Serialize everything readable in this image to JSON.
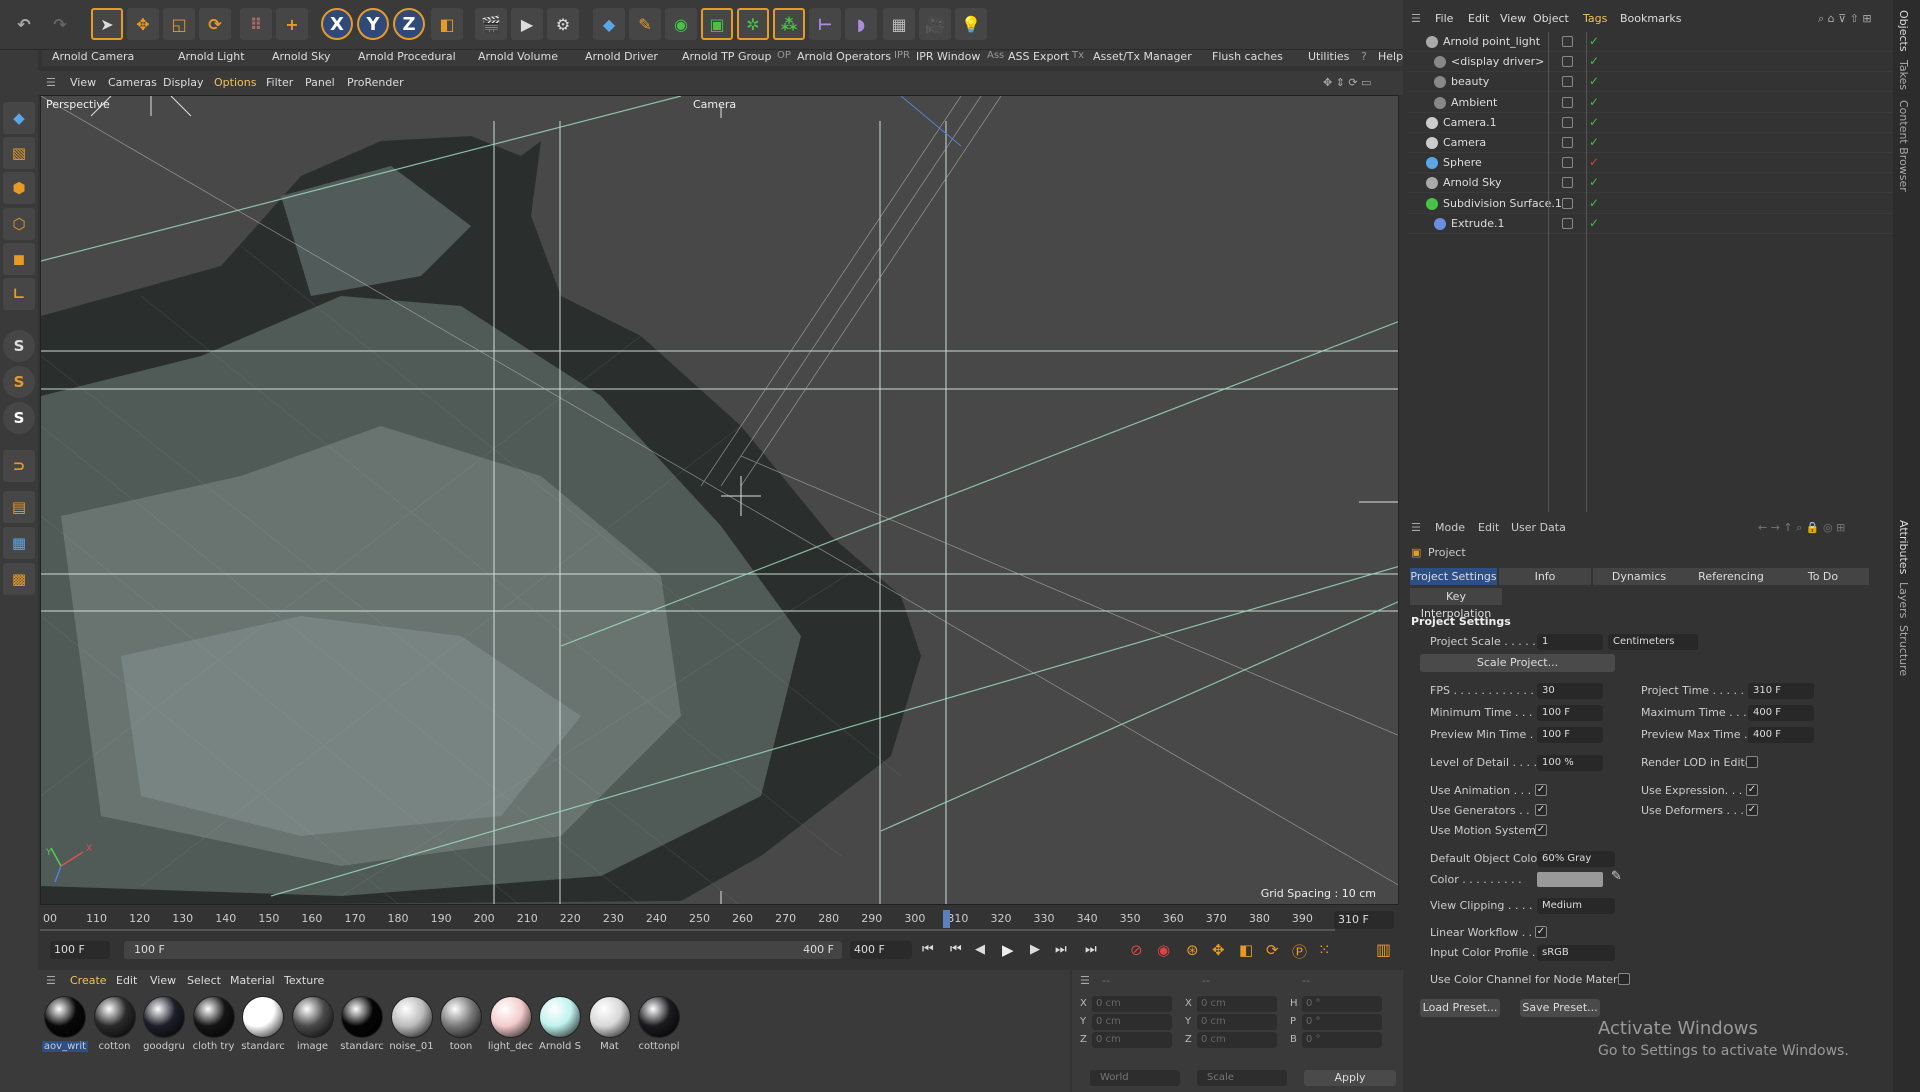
{
  "toolbar": {
    "icons": [
      "undo-icon",
      "redo-icon",
      "select-icon",
      "move-icon",
      "scale-icon",
      "rotate-icon",
      "model-icon",
      "add-icon",
      "x-axis-icon",
      "y-axis-icon",
      "z-axis-icon",
      "coord-system-icon",
      "render-region-icon",
      "render-view-icon",
      "render-settings-icon",
      "cube-icon",
      "pen-icon",
      "subdivision-icon",
      "extrude-icon",
      "mograph-icon",
      "array-icon",
      "symmetry-icon",
      "deformer-icon",
      "floor-icon",
      "camera-icon",
      "light-icon"
    ],
    "axis_x": "X",
    "axis_y": "Y",
    "axis_z": "Z"
  },
  "plugin_bar": [
    "Arnold Camera",
    "Arnold Light",
    "Arnold Sky",
    "Arnold Procedural",
    "Arnold Volume",
    "Arnold Driver",
    "Arnold TP Group",
    "Arnold Operators",
    "IPR Window",
    "ASS Export",
    "Asset/Tx Manager",
    "Flush caches",
    "Utilities",
    "Help"
  ],
  "plugin_bar_prefixes": [
    "IPR",
    "Ass",
    "Tx",
    "?"
  ],
  "viewport": {
    "menu": [
      "View",
      "Cameras",
      "Display",
      "Options",
      "Filter",
      "Panel",
      "ProRender"
    ],
    "active_menu": "Options",
    "view_name": "Perspective",
    "camera_label": "Camera",
    "grid_spacing": "Grid Spacing : 10 cm",
    "axis_labels": [
      "X",
      "Y"
    ]
  },
  "timeline": {
    "ticks": [
      "00",
      "110",
      "120",
      "130",
      "140",
      "150",
      "160",
      "170",
      "180",
      "190",
      "200",
      "210",
      "220",
      "230",
      "240",
      "250",
      "260",
      "270",
      "280",
      "290",
      "300",
      "310",
      "320",
      "330",
      "340",
      "350",
      "360",
      "370",
      "380",
      "390",
      "400"
    ],
    "current_frame": "310 F",
    "current_marker": "310"
  },
  "playback": {
    "start": "100 F",
    "range_start": "100 F",
    "range_end": "400 F",
    "end": "400 F"
  },
  "materials": {
    "menu": [
      "Create",
      "Edit",
      "View",
      "Select",
      "Material",
      "Texture"
    ],
    "items": [
      {
        "name": "aov_writ",
        "color": "#080808"
      },
      {
        "name": "cotton",
        "color": "#2a2a2a"
      },
      {
        "name": "goodgru",
        "color": "#1e1e2a"
      },
      {
        "name": "cloth try",
        "color": "#151515"
      },
      {
        "name": "standarc",
        "color": "#ffffff"
      },
      {
        "name": "image",
        "color": "#4a4a4a"
      },
      {
        "name": "standarc",
        "color": "#050505"
      },
      {
        "name": "noise_01",
        "color": "#bcbcbc"
      },
      {
        "name": "toon",
        "color": "#7a7a7a"
      },
      {
        "name": "light_dec",
        "color": "#f4cccc"
      },
      {
        "name": "Arnold S",
        "color": "#bff2ee"
      },
      {
        "name": "Mat",
        "color": "#d8d8d8"
      },
      {
        "name": "cottonpl",
        "color": "#1b1b1f"
      }
    ]
  },
  "coordinates": {
    "header": [
      "--",
      "--",
      "--"
    ],
    "rows": [
      {
        "a": "X",
        "av": "0 cm",
        "b": "X",
        "bv": "0 cm",
        "c": "H",
        "cv": "0 °"
      },
      {
        "a": "Y",
        "av": "0 cm",
        "b": "Y",
        "bv": "0 cm",
        "c": "P",
        "cv": "0 °"
      },
      {
        "a": "Z",
        "av": "0 cm",
        "b": "Z",
        "bv": "0 cm",
        "c": "B",
        "cv": "0 °"
      }
    ],
    "world": "World",
    "scale": "Scale",
    "apply": "Apply"
  },
  "object_manager": {
    "menu": [
      "File",
      "Edit",
      "View",
      "Object",
      "Tags",
      "Bookmarks"
    ],
    "objects": [
      {
        "name": "Arnold point_light",
        "color": "#aaaaaa"
      },
      {
        "name": "<display driver>",
        "color": "#888888"
      },
      {
        "name": "beauty",
        "color": "#888888"
      },
      {
        "name": "Ambient",
        "color": "#888888"
      },
      {
        "name": "Camera.1",
        "color": "#cccccc"
      },
      {
        "name": "Camera",
        "color": "#cccccc"
      },
      {
        "name": "Sphere",
        "color": "#5aa6e6"
      },
      {
        "name": "Arnold Sky",
        "color": "#aaaaaa"
      },
      {
        "name": "Subdivision Surface.1",
        "color": "#47c447"
      },
      {
        "name": "Extrude.1",
        "color": "#6a8ee0"
      }
    ]
  },
  "attributes": {
    "menu": [
      "Mode",
      "Edit",
      "User Data"
    ],
    "object": "Project",
    "tabs": [
      "Project Settings",
      "Info",
      "Dynamics",
      "Referencing",
      "To Do"
    ],
    "tab2": "Key Interpolation",
    "section": "Project Settings",
    "project_scale_label": "Project Scale . . . . .",
    "project_scale": "1",
    "unit": "Centimeters",
    "scale_project": "Scale Project...",
    "fps_label": "FPS . . . . . . . . . . . .",
    "fps": "30",
    "project_time_label": "Project Time . . . . .",
    "project_time": "310 F",
    "min_time_label": "Minimum Time . . .",
    "min_time": "100 F",
    "max_time_label": "Maximum Time . . .",
    "max_time": "400 F",
    "prev_min_label": "Preview Min Time . .",
    "prev_min": "100 F",
    "prev_max_label": "Preview Max Time . .",
    "prev_max": "400 F",
    "lod_label": "Level of Detail . . . .",
    "lod": "100 %",
    "render_lod_label": "Render LOD in Editor",
    "use_anim": "Use Animation . . .",
    "use_expr": "Use Expression. . .",
    "use_gen": "Use Generators . .",
    "use_def": "Use Deformers . . .",
    "use_motion": "Use Motion System",
    "def_color_label": "Default Object Color",
    "def_color": "60% Gray",
    "color_label": "Color . . . . . . . . .",
    "view_clip_label": "View Clipping . . . .",
    "view_clip": "Medium",
    "linear_label": "Linear Workflow . . .",
    "input_profile_label": "Input Color Profile . .",
    "input_profile": "sRGB",
    "use_color_node": "Use Color Channel for Node Material",
    "load_preset": "Load Preset...",
    "save_preset": "Save Preset...",
    "check": "✓"
  },
  "side_tabs": [
    "Objects",
    "Takes",
    "Content Browser",
    "Attributes",
    "Layers",
    "Structure"
  ],
  "watermark": {
    "line1": "Activate Windows",
    "line2": "Go to Settings to activate Windows."
  }
}
